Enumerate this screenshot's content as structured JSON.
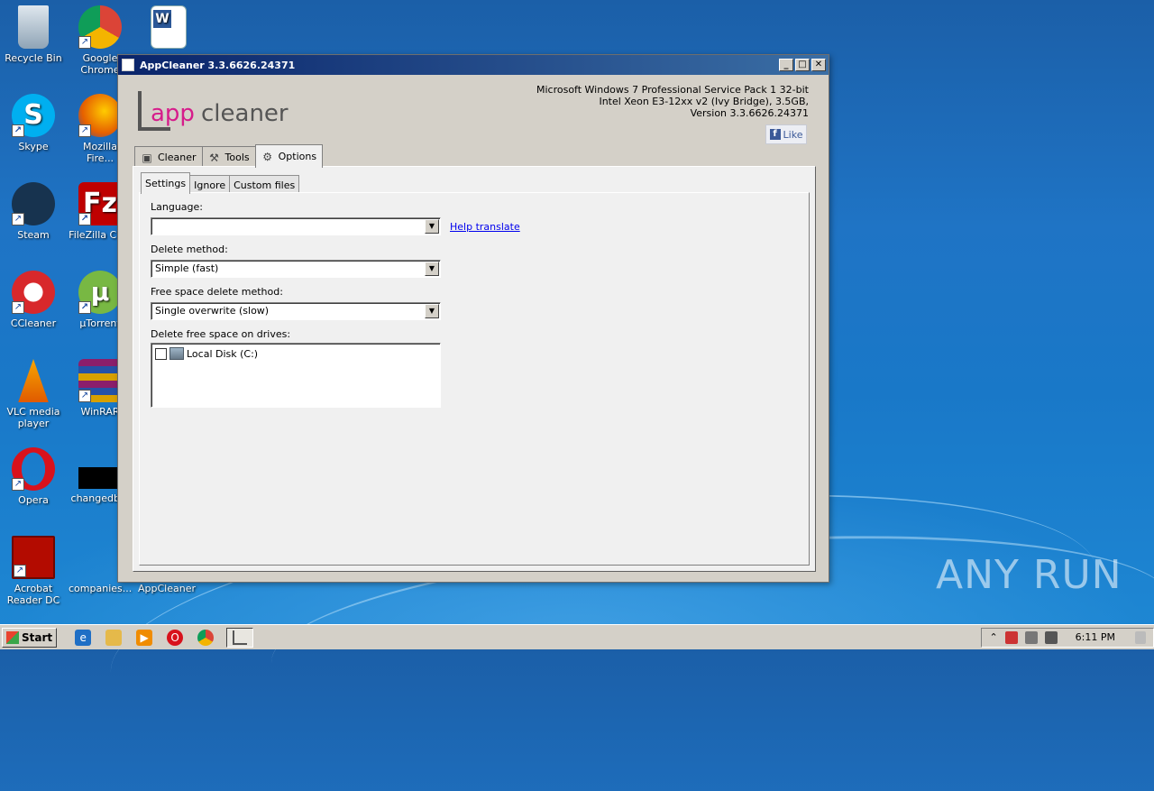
{
  "desktop": {
    "icons": [
      {
        "label": "Recycle Bin",
        "icon": "recycle-bin-icon"
      },
      {
        "label": "Google Chrome",
        "icon": "chrome-icon"
      },
      {
        "label": "",
        "icon": "word-document-icon"
      },
      {
        "label": "Skype",
        "icon": "skype-icon"
      },
      {
        "label": "Mozilla Fire...",
        "icon": "firefox-icon"
      },
      {
        "label": "Steam",
        "icon": "steam-icon"
      },
      {
        "label": "FileZilla Cli...",
        "icon": "filezilla-icon"
      },
      {
        "label": "CCleaner",
        "icon": "ccleaner-icon"
      },
      {
        "label": "µTorrent",
        "icon": "utorrent-icon"
      },
      {
        "label": "VLC media player",
        "icon": "vlc-icon"
      },
      {
        "label": "WinRAR",
        "icon": "winrar-icon"
      },
      {
        "label": "Opera",
        "icon": "opera-icon"
      },
      {
        "label": "changedb...",
        "icon": "file-icon"
      },
      {
        "label": "Acrobat Reader DC",
        "icon": "acrobat-icon"
      },
      {
        "label": "companies...",
        "icon": "file-icon"
      },
      {
        "label": "AppCleaner",
        "icon": "appcleaner-icon"
      }
    ],
    "watermark": "ANY RUN"
  },
  "window": {
    "title": "AppCleaner 3.3.6626.24371",
    "logo": {
      "part1": "app",
      "part2": "cleaner"
    },
    "sysinfo": {
      "line1": "Microsoft Windows 7 Professional Service Pack 1 32-bit",
      "line2": "Intel Xeon E3-12xx v2 (Ivy Bridge), 3.5GB,",
      "line3": "Version 3.3.6626.24371"
    },
    "like_label": "Like",
    "tabs": [
      {
        "label": "Cleaner",
        "icon": "cleaner-icon"
      },
      {
        "label": "Tools",
        "icon": "tools-icon"
      },
      {
        "label": "Options",
        "icon": "gear-icon",
        "active": true
      }
    ],
    "subtabs": [
      {
        "label": "Settings",
        "active": true
      },
      {
        "label": "Ignore"
      },
      {
        "label": "Custom files"
      }
    ],
    "settings": {
      "language_label": "Language:",
      "language_value": "",
      "help_translate": "Help translate",
      "delete_method_label": "Delete method:",
      "delete_method_value": "Simple (fast)",
      "free_space_label": "Free space delete method:",
      "free_space_value": "Single overwrite (slow)",
      "drives_label": "Delete free space on drives:",
      "drives": [
        {
          "label": "Local Disk (C:)",
          "checked": false
        }
      ]
    }
  },
  "taskbar": {
    "start_label": "Start",
    "clock": "6:11 PM",
    "quick_launch": [
      "ie-icon",
      "explorer-icon",
      "media-player-icon",
      "opera-icon",
      "chrome-icon"
    ],
    "active_app": "appcleaner-icon"
  },
  "colors": {
    "titlebar": "#0a246a",
    "logo_accent": "#d61c8b",
    "link": "#0000ee",
    "desktop": "#1f74c5"
  }
}
